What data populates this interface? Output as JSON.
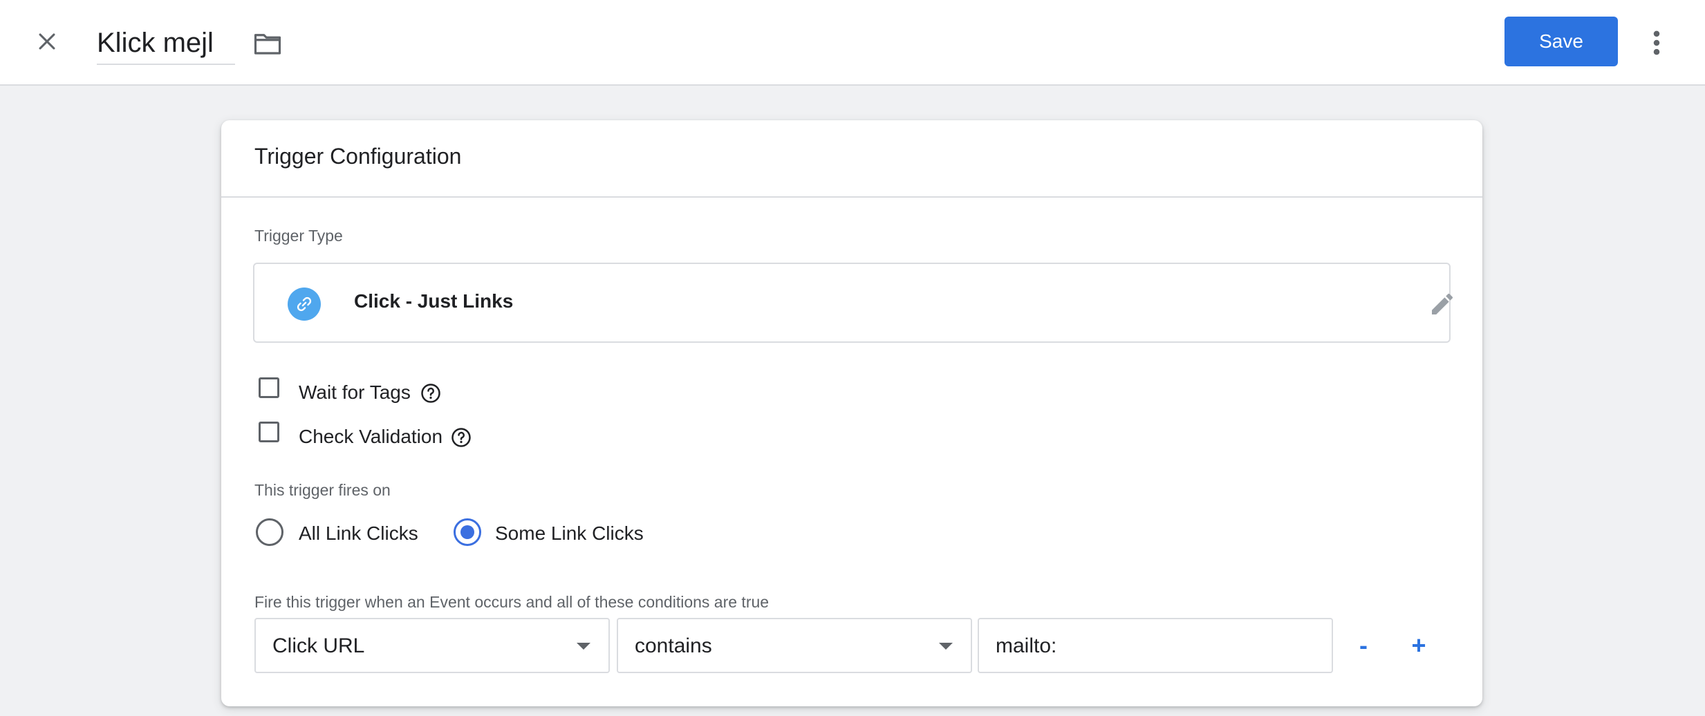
{
  "header": {
    "close_icon": "close-icon",
    "title": "Klick mejl",
    "folder_icon": "folder-icon",
    "save_label": "Save",
    "more_icon": "more-vert-icon"
  },
  "trigger_config": {
    "title": "Trigger Configuration",
    "type_label": "Trigger Type",
    "type": {
      "icon": "link-icon",
      "name": "Click - Just Links",
      "edit_icon": "pencil-icon"
    },
    "options": [
      {
        "label": "Wait for Tags",
        "checked": false
      },
      {
        "label": "Check Validation",
        "checked": false
      }
    ],
    "fires_on_label": "This trigger fires on",
    "fires_on": [
      {
        "label": "All Link Clicks",
        "selected": false
      },
      {
        "label": "Some Link Clicks",
        "selected": true
      }
    ],
    "conditions_label": "Fire this trigger when an Event occurs and all of these conditions are true",
    "condition": {
      "variable": "Click URL",
      "operator": "contains",
      "value": "mailto:"
    },
    "remove_label": "-",
    "add_label": "+"
  },
  "colors": {
    "accent": "#2c73e0",
    "link_icon_bg": "#4fa7ee",
    "radio_checked": "#3b6fe0"
  }
}
